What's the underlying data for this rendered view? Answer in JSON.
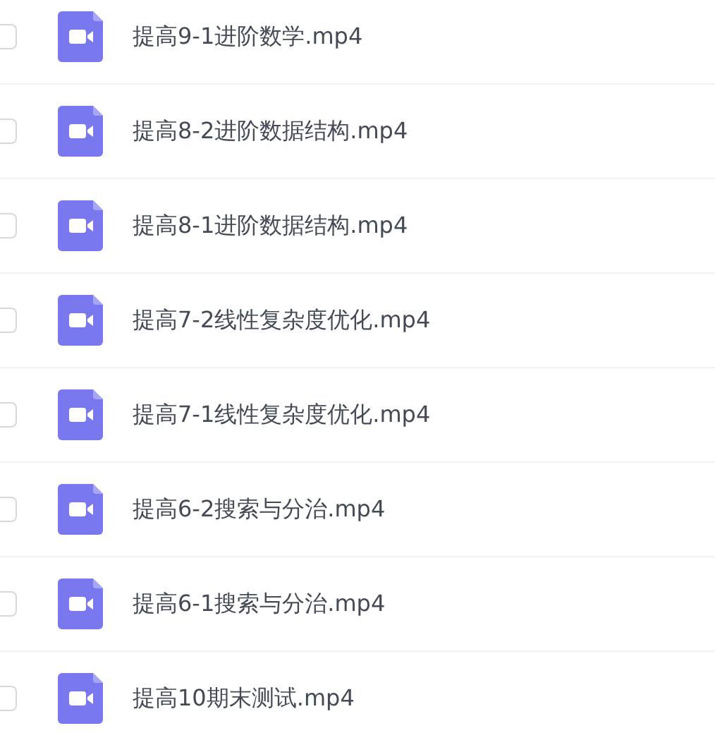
{
  "files": [
    {
      "name": "提高9-1进阶数学.mp4",
      "checked": false
    },
    {
      "name": "提高8-2进阶数据结构.mp4",
      "checked": false
    },
    {
      "name": "提高8-1进阶数据结构.mp4",
      "checked": false
    },
    {
      "name": "提高7-2线性复杂度优化.mp4",
      "checked": false
    },
    {
      "name": "提高7-1线性复杂度优化.mp4",
      "checked": false
    },
    {
      "name": "提高6-2搜索与分治.mp4",
      "checked": false
    },
    {
      "name": "提高6-1搜索与分治.mp4",
      "checked": false
    },
    {
      "name": "提高10期末测试.mp4",
      "checked": false
    }
  ]
}
